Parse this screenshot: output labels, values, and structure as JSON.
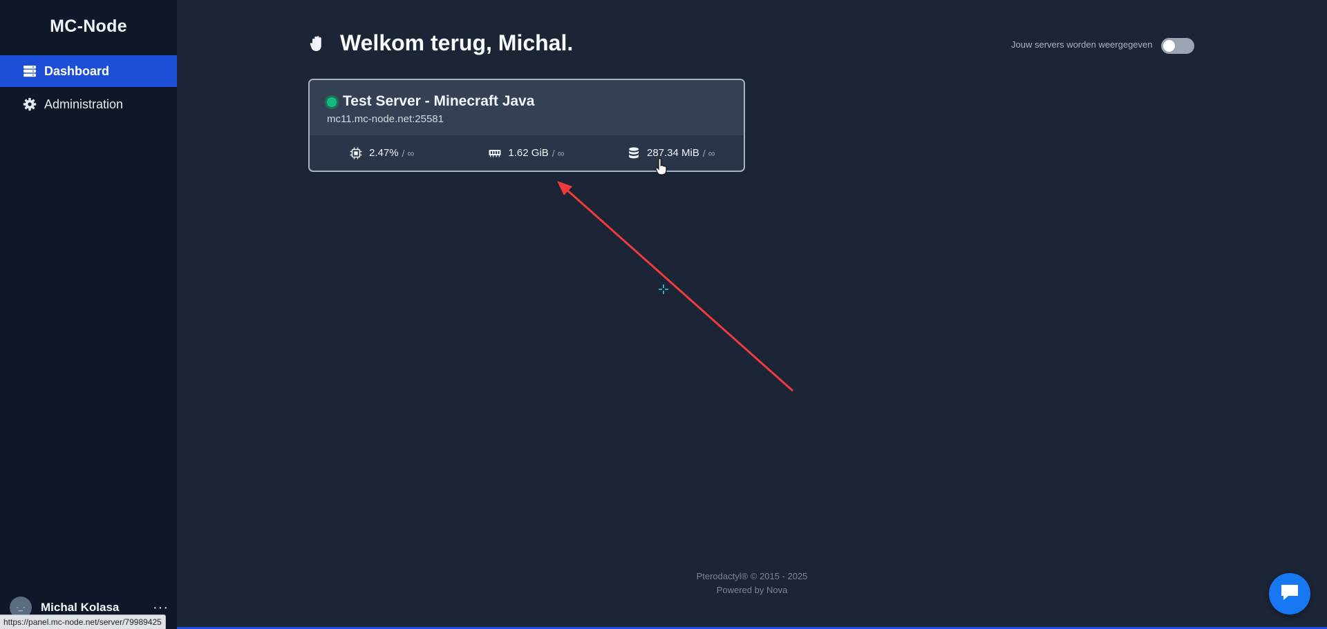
{
  "sidebar": {
    "brand": "MC-Node",
    "items": [
      {
        "label": "Dashboard",
        "icon": "server-icon",
        "active": true
      },
      {
        "label": "Administration",
        "icon": "gear-icon",
        "active": false
      }
    ],
    "user": {
      "name": "Michal Kolasa",
      "avatar_text": "·_·"
    }
  },
  "header": {
    "welcome": "Welkom terug, Michal.",
    "toggle_label": "Jouw servers worden weergegeven",
    "toggle_on": false
  },
  "servers": [
    {
      "name": "Test Server - Minecraft Java",
      "address": "mc11.mc-node.net:25581",
      "status": "online",
      "cpu": "2.47%",
      "cpu_limit": "/ ∞",
      "memory": "1.62 GiB",
      "memory_limit": "/ ∞",
      "disk": "287.34 MiB",
      "disk_limit": "/ ∞"
    }
  ],
  "footer": {
    "line1": "Pterodactyl® © 2015 - 2025",
    "line2": "Powered by Nova"
  },
  "status_bar_url": "https://panel.mc-node.net/server/79989425",
  "colors": {
    "accent": "#1d4ed8",
    "background": "#1c2536",
    "sidebar": "#0f1729",
    "online": "#10b981",
    "annotation": "#ef3b3b",
    "chat": "#1877f2"
  }
}
